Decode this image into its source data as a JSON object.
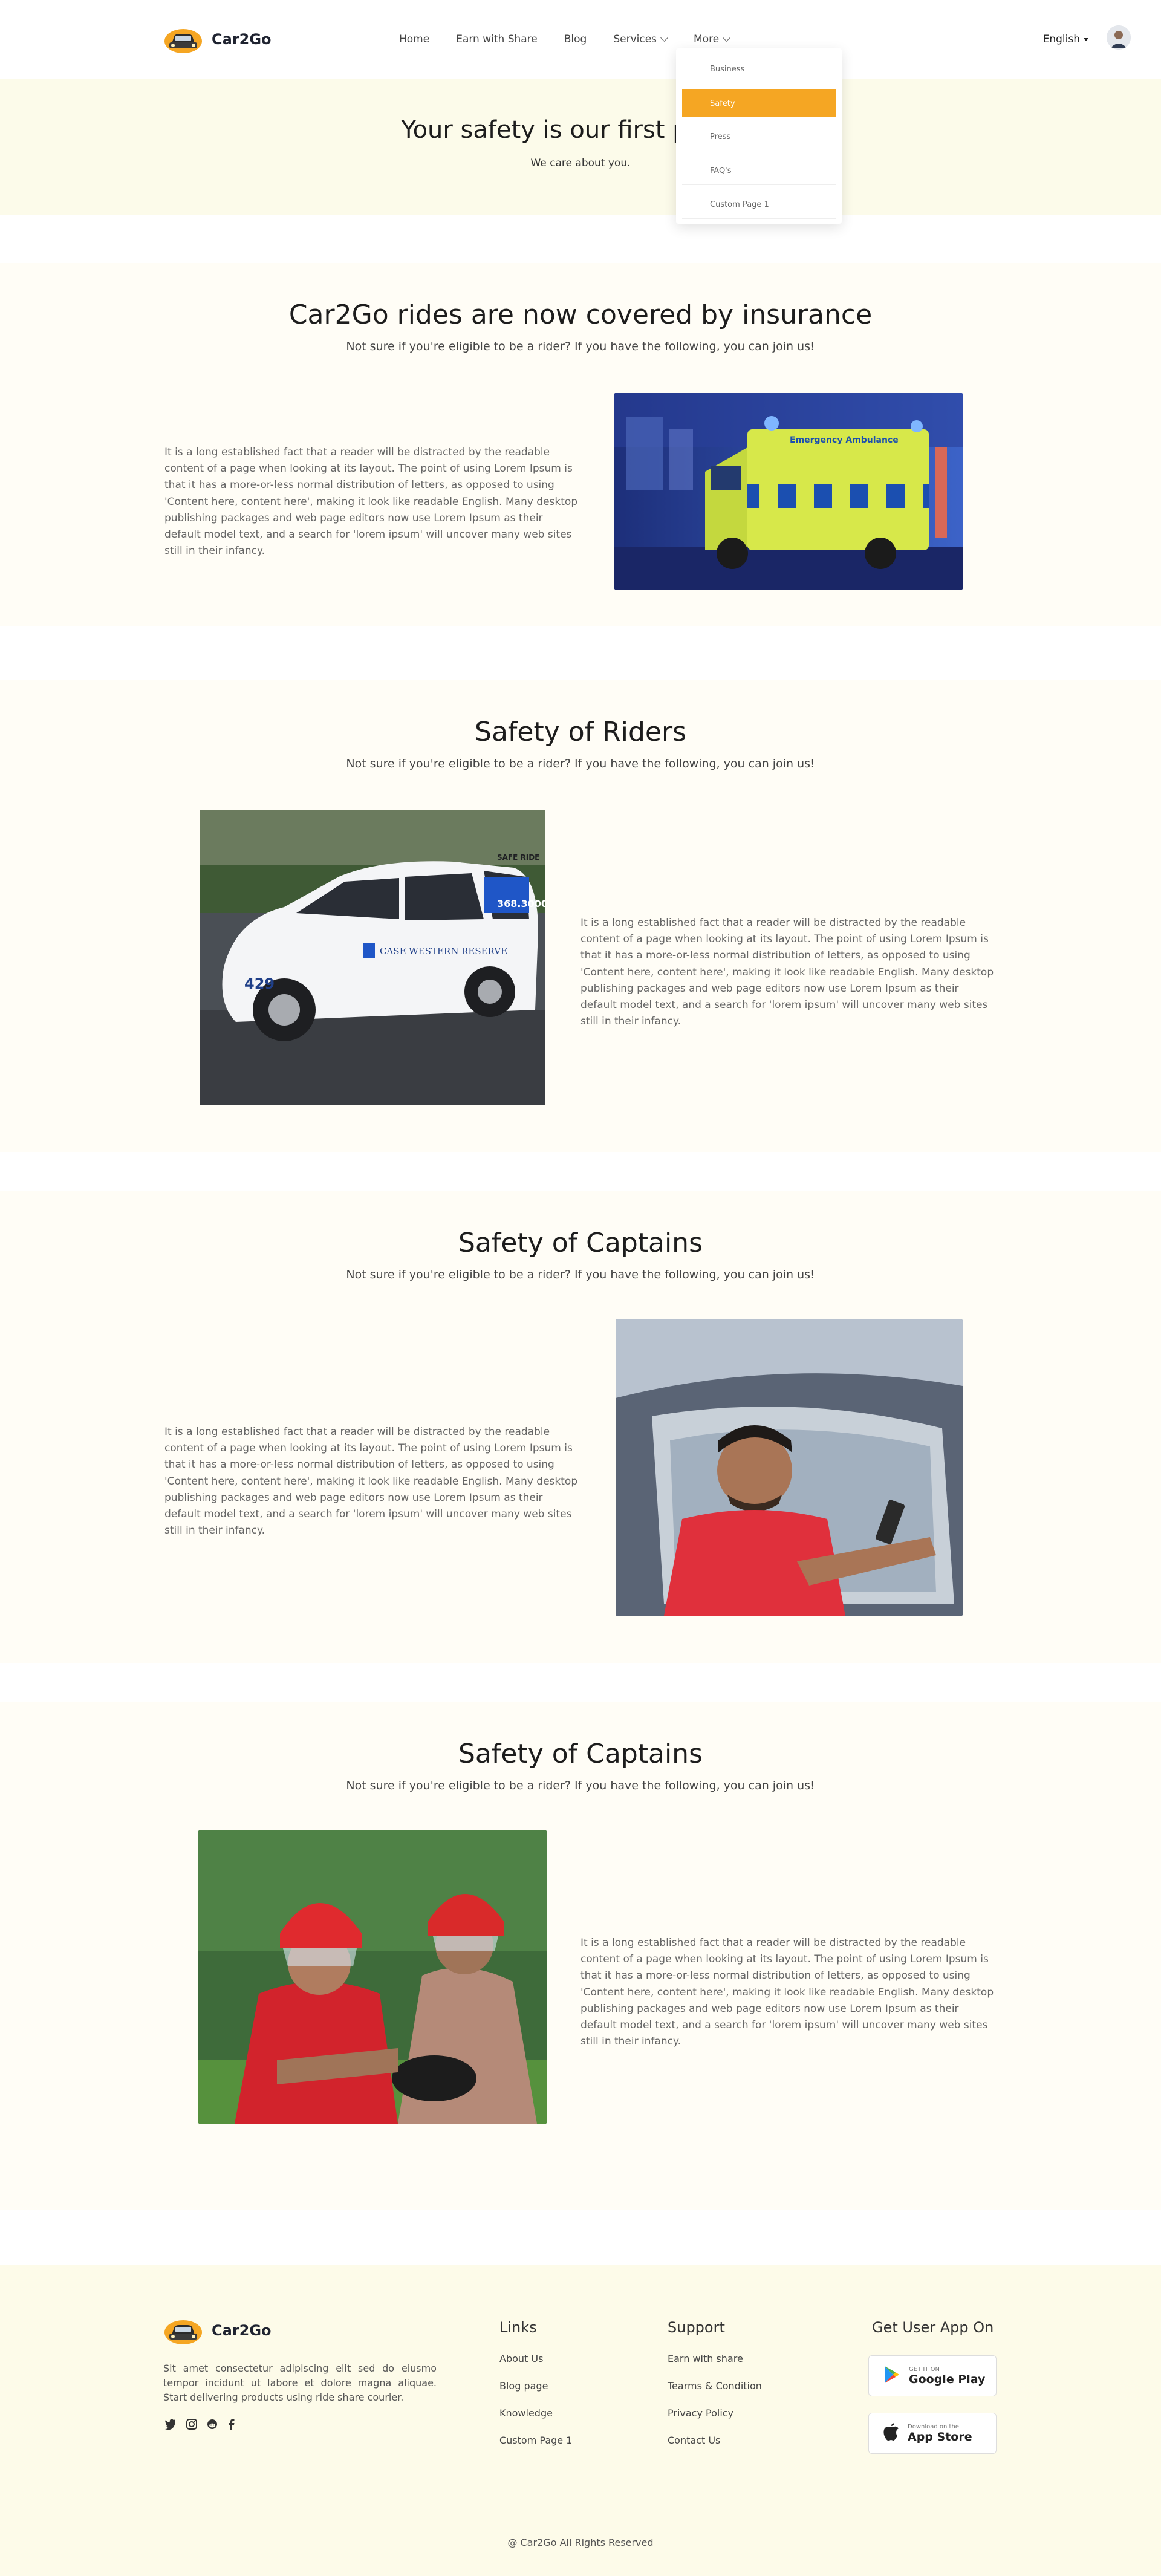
{
  "brand": {
    "name": "Car2Go"
  },
  "nav": {
    "items": [
      {
        "label": "Home"
      },
      {
        "label": "Earn with Share"
      },
      {
        "label": "Blog"
      },
      {
        "label": "Services"
      },
      {
        "label": "More"
      }
    ]
  },
  "language": {
    "label": "English"
  },
  "dropdown": {
    "items": [
      {
        "label": "Business"
      },
      {
        "label": "Safety"
      },
      {
        "label": "Press"
      },
      {
        "label": "FAQ's"
      },
      {
        "label": "Custom Page 1"
      }
    ]
  },
  "hero": {
    "title": "Your safety is our first priority",
    "subtitle": "We care about you."
  },
  "sections": [
    {
      "title": "Car2Go rides are now covered by insurance",
      "subtitle": "Not sure if you're eligible to be a rider? If you have the following, you can join us!",
      "text": "It is a long established fact that a reader will be distracted by the readable content of a page when looking at its layout. The point of using Lorem Ipsum is that it has a more-or-less normal distribution of letters, as opposed to using 'Content here, content here', making it look like readable English. Many desktop publishing packages and web page editors now use Lorem Ipsum as their default model text, and a search for 'lorem ipsum' will uncover many web sites still in their infancy."
    },
    {
      "title": "Safety of Riders",
      "subtitle": "Not sure if you're eligible to be a rider? If you have the following, you can join us!",
      "text": "It is a long established fact that a reader will be distracted by the readable content of a page when looking at its layout. The point of using Lorem Ipsum is that it has a more-or-less normal distribution of letters, as opposed to using 'Content here, content here', making it look like readable English. Many desktop publishing packages and web page editors now use Lorem Ipsum as their default model text, and a search for 'lorem ipsum' will uncover many web sites still in their infancy."
    },
    {
      "title": "Safety of Captains",
      "subtitle": "Not sure if you're eligible to be a rider? If you have the following, you can join us!",
      "text": "It is a long established fact that a reader will be distracted by the readable content of a page when looking at its layout. The point of using Lorem Ipsum is that it has a more-or-less normal distribution of letters, as opposed to using 'Content here, content here', making it look like readable English. Many desktop publishing packages and web page editors now use Lorem Ipsum as their default model text, and a search for 'lorem ipsum' will uncover many web sites still in their infancy."
    },
    {
      "title": "Safety of Captains",
      "subtitle": "Not sure if you're eligible to be a rider? If you have the following, you can join us!",
      "text": "It is a long established fact that a reader will be distracted by the readable content of a page when looking at its layout. The point of using Lorem Ipsum is that it has a more-or-less normal distribution of letters, as opposed to using 'Content here, content here', making it look like readable English. Many desktop publishing packages and web page editors now use Lorem Ipsum as their default model text, and a search for 'lorem ipsum' will uncover many web sites still in their infancy."
    }
  ],
  "images": {
    "ambulance": {
      "text": "Emergency Ambulance"
    },
    "taxi": {
      "number": "429",
      "phone": "368.3000",
      "brand": "CASE WESTERN RESERVE",
      "sign": "SAFE RIDE"
    }
  },
  "footer": {
    "brand": "Car2Go",
    "description": "Sit amet consectetur adipiscing elit sed do eiusmo tempor incidunt ut labore et dolore magna aliquae. Start delivering products using ride share courier.",
    "links": {
      "title": "Links",
      "items": [
        "About Us",
        "Blog page",
        "Knowledge",
        "Custom Page 1"
      ]
    },
    "support": {
      "title": "Support",
      "items": [
        "Earn with share",
        "Tearms & Condition",
        "Privacy Policy",
        "Contact Us"
      ]
    },
    "apps": {
      "title": "Get User App On",
      "google_small": "GET IT ON",
      "google_big": "Google Play",
      "apple_small": "Download on the",
      "apple_big": "App Store"
    },
    "copyright": "@ Car2Go All Rights Reserved"
  },
  "colors": {
    "accent": "#f5a623",
    "hero_bg": "#fcfbea",
    "section_bg": "#fffdf6",
    "footer_bg": "#fdfbe9"
  }
}
